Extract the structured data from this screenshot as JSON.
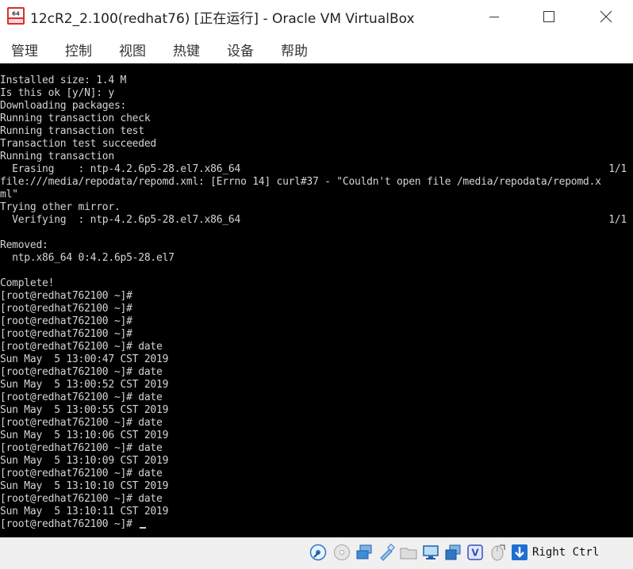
{
  "window": {
    "title": "12cR2_2.100(redhat76) [正在运行] - Oracle VM VirtualBox"
  },
  "menu": {
    "items": [
      "管理",
      "控制",
      "视图",
      "热键",
      "设备",
      "帮助"
    ]
  },
  "console": {
    "lines": [
      "Installed size: 1.4 M",
      "Is this ok [y/N]: y",
      "Downloading packages:",
      "Running transaction check",
      "Running transaction test",
      "Transaction test succeeded",
      "Running transaction",
      "  Erasing    : ntp-4.2.6p5-28.el7.x86_64",
      "file:///media/repodata/repomd.xml: [Errno 14] curl#37 - \"Couldn't open file /media/repodata/repomd.x",
      "ml\"",
      "Trying other mirror.",
      "  Verifying  : ntp-4.2.6p5-28.el7.x86_64",
      "",
      "Removed:",
      "  ntp.x86_64 0:4.2.6p5-28.el7",
      "",
      "Complete!",
      "[root@redhat762100 ~]#",
      "[root@redhat762100 ~]#",
      "[root@redhat762100 ~]#",
      "[root@redhat762100 ~]#",
      "[root@redhat762100 ~]# date",
      "Sun May  5 13:00:47 CST 2019",
      "[root@redhat762100 ~]# date",
      "Sun May  5 13:00:52 CST 2019",
      "[root@redhat762100 ~]# date",
      "Sun May  5 13:00:55 CST 2019",
      "[root@redhat762100 ~]# date",
      "Sun May  5 13:10:06 CST 2019",
      "[root@redhat762100 ~]# date",
      "Sun May  5 13:10:09 CST 2019",
      "[root@redhat762100 ~]# date",
      "Sun May  5 13:10:10 CST 2019",
      "[root@redhat762100 ~]# date",
      "Sun May  5 13:10:11 CST 2019",
      "[root@redhat762100 ~]# "
    ],
    "erasing_progress": "1/1",
    "verifying_progress": "1/1"
  },
  "statusbar": {
    "host_key": "Right Ctrl",
    "icons": [
      "hard-disk-icon",
      "optical-drive-icon",
      "network-icon",
      "usb-icon",
      "shared-folders-icon",
      "display-icon",
      "recording-icon",
      "virtualization-icon",
      "mouse-integration-icon",
      "keyboard-capture-icon"
    ]
  }
}
